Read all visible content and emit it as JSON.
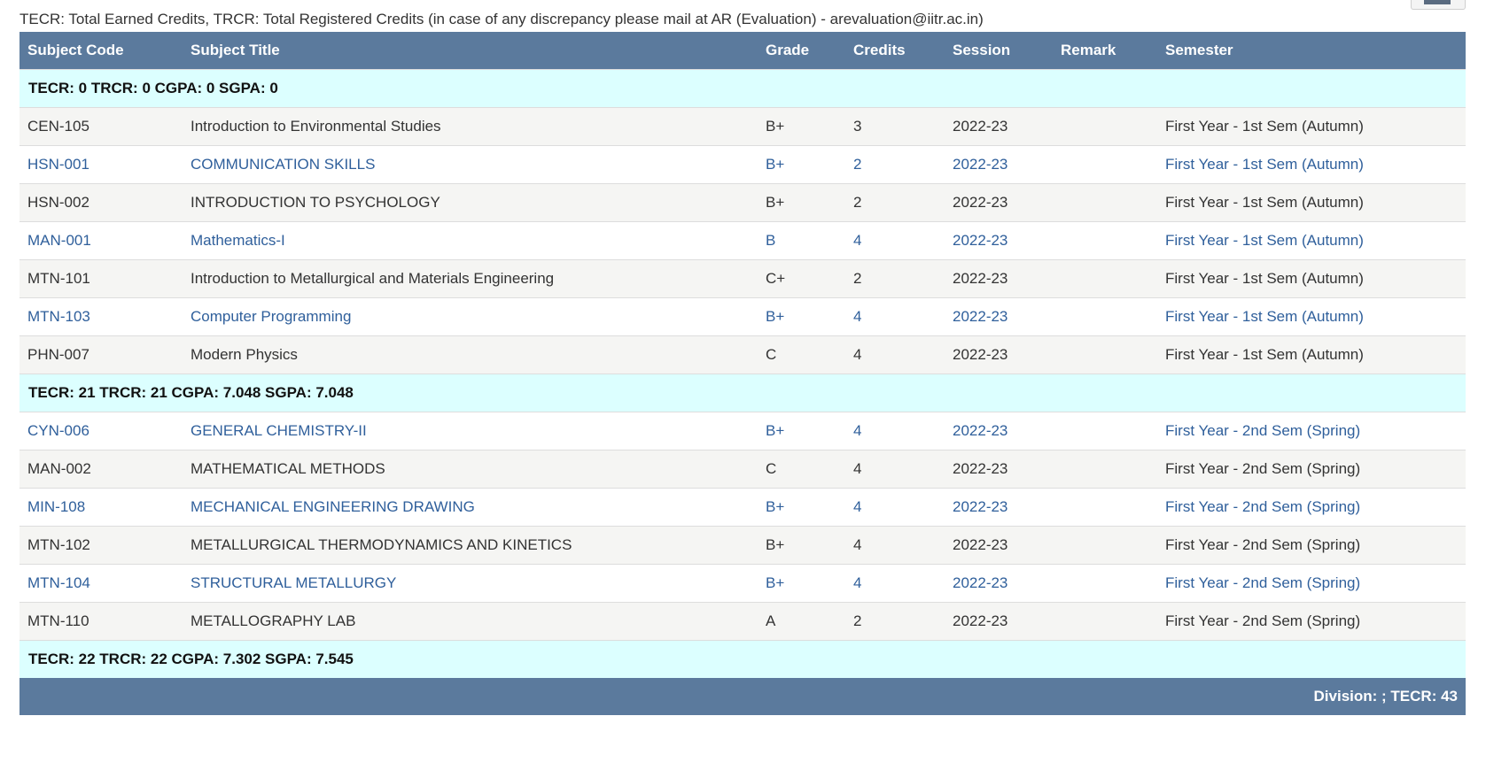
{
  "note": "TECR: Total Earned Credits, TRCR: Total Registered Credits (in case of any discrepancy please mail at AR (Evaluation) - arevaluation@iitr.ac.in)",
  "headers": [
    "Subject Code",
    "Subject Title",
    "Grade",
    "Credits",
    "Session",
    "Remark",
    "Semester"
  ],
  "summary_0": "TECR: 0 TRCR: 0 CGPA: 0 SGPA: 0",
  "sem1": [
    {
      "code": "CEN-105",
      "title": "Introduction to Environmental Studies",
      "grade": "B+",
      "credits": "3",
      "session": "2022-23",
      "remark": "",
      "semester": "First Year - 1st Sem (Autumn)"
    },
    {
      "code": "HSN-001",
      "title": "COMMUNICATION SKILLS",
      "grade": "B+",
      "credits": "2",
      "session": "2022-23",
      "remark": "",
      "semester": "First Year - 1st Sem (Autumn)"
    },
    {
      "code": "HSN-002",
      "title": "INTRODUCTION TO PSYCHOLOGY",
      "grade": "B+",
      "credits": "2",
      "session": "2022-23",
      "remark": "",
      "semester": "First Year - 1st Sem (Autumn)"
    },
    {
      "code": "MAN-001",
      "title": "Mathematics-I",
      "grade": "B",
      "credits": "4",
      "session": "2022-23",
      "remark": "",
      "semester": "First Year - 1st Sem (Autumn)"
    },
    {
      "code": "MTN-101",
      "title": "Introduction to Metallurgical and Materials Engineering",
      "grade": "C+",
      "credits": "2",
      "session": "2022-23",
      "remark": "",
      "semester": "First Year - 1st Sem (Autumn)"
    },
    {
      "code": "MTN-103",
      "title": "Computer Programming",
      "grade": "B+",
      "credits": "4",
      "session": "2022-23",
      "remark": "",
      "semester": "First Year - 1st Sem (Autumn)"
    },
    {
      "code": "PHN-007",
      "title": "Modern Physics",
      "grade": "C",
      "credits": "4",
      "session": "2022-23",
      "remark": "",
      "semester": "First Year - 1st Sem (Autumn)"
    }
  ],
  "summary_1": "TECR: 21 TRCR: 21 CGPA: 7.048 SGPA: 7.048",
  "sem2": [
    {
      "code": "CYN-006",
      "title": "GENERAL CHEMISTRY-II",
      "grade": "B+",
      "credits": "4",
      "session": "2022-23",
      "remark": "",
      "semester": "First Year - 2nd Sem (Spring)"
    },
    {
      "code": "MAN-002",
      "title": "MATHEMATICAL METHODS",
      "grade": "C",
      "credits": "4",
      "session": "2022-23",
      "remark": "",
      "semester": "First Year - 2nd Sem (Spring)"
    },
    {
      "code": "MIN-108",
      "title": "MECHANICAL ENGINEERING DRAWING",
      "grade": "B+",
      "credits": "4",
      "session": "2022-23",
      "remark": "",
      "semester": "First Year - 2nd Sem (Spring)"
    },
    {
      "code": "MTN-102",
      "title": "METALLURGICAL THERMODYNAMICS AND KINETICS",
      "grade": "B+",
      "credits": "4",
      "session": "2022-23",
      "remark": "",
      "semester": "First Year - 2nd Sem (Spring)"
    },
    {
      "code": "MTN-104",
      "title": "STRUCTURAL METALLURGY",
      "grade": "B+",
      "credits": "4",
      "session": "2022-23",
      "remark": "",
      "semester": "First Year - 2nd Sem (Spring)"
    },
    {
      "code": "MTN-110",
      "title": "METALLOGRAPHY LAB",
      "grade": "A",
      "credits": "2",
      "session": "2022-23",
      "remark": "",
      "semester": "First Year - 2nd Sem (Spring)"
    }
  ],
  "summary_2": "TECR: 22 TRCR: 22 CGPA: 7.302 SGPA: 7.545",
  "footer": "Division: ; TECR: 43",
  "colors": {
    "header_bg": "#5b7a9d",
    "summary_bg": "#dcffff",
    "link_text": "#2f5f9b",
    "stripe_bg": "#f5f5f3"
  }
}
